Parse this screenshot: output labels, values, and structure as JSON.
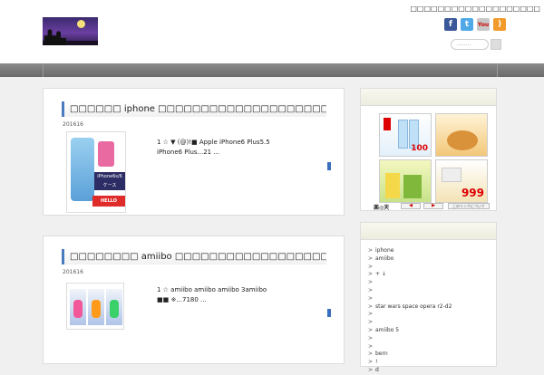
{
  "header": {
    "tagline": "□□□□□□□□□□□□□□□□□□□",
    "search_placeholder": "........",
    "social": [
      {
        "icon": "facebook-icon",
        "glyph": "f"
      },
      {
        "icon": "twitter-icon",
        "glyph": "t"
      },
      {
        "icon": "youtube-icon",
        "glyph": "You"
      },
      {
        "icon": "rss-icon",
        "glyph": ")"
      }
    ]
  },
  "articles": [
    {
      "title": "□□□□□□ iphone □□□□□□□□□□□□□□□□□□□□□□□□□□□□□□□□□□□□□□□□□□",
      "date": "201616",
      "excerpt_line1": "1  ☆ ▼ (@)!■ Apple iPhone6 Plus5.5",
      "excerpt_line2": "iPhone6 Plus...21  ...",
      "thumb_label": "iPhone6s/6 ケース",
      "thumb_brand": "HELLO KITTY"
    },
    {
      "title": "□□□□□□□□ amiibo □□□□□□□□□□□□□□□□□□□□□□□□□□□□□□□□□□□□",
      "date": "201616",
      "excerpt_line1": "1  ☆ amiibo  amiibo amiibo  3amiibo",
      "excerpt_line2": "■■ ※...7180  ..."
    }
  ],
  "ad_widget": {
    "price1": "100",
    "price2": "999",
    "rakuten_logo": "楽◎天",
    "prev_label": "◀",
    "next_label": "▶",
    "link_label": "このリンクについて"
  },
  "categories": [
    "iphone",
    "amiibo",
    "",
    "+  ↓",
    "",
    "",
    "",
    "star wars space opera r2-d2",
    "",
    "",
    "amiibo 5",
    "",
    "",
    "bern",
    "!",
    "d"
  ]
}
